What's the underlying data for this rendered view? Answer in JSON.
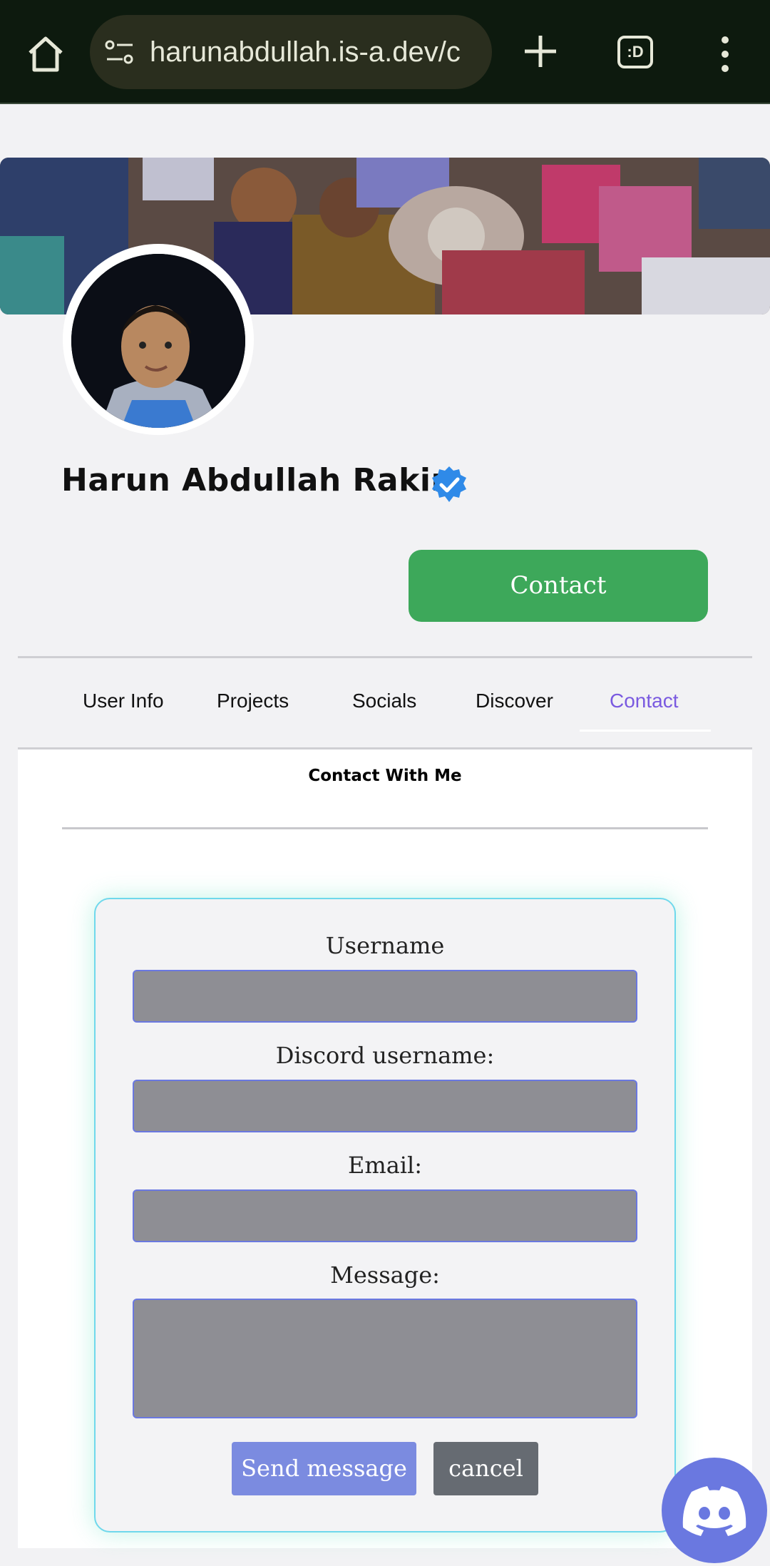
{
  "browser": {
    "url": "harunabdullah.is-a.dev/c",
    "tabs_label": ":D",
    "icons": [
      "home-icon",
      "site-settings-icon",
      "new-tab-icon",
      "tab-switcher-icon",
      "menu-icon"
    ]
  },
  "profile": {
    "name": "Harun Abdullah Rakin",
    "verified": true,
    "contact_button": "Contact"
  },
  "tabs": [
    {
      "label": "User Info",
      "active": false
    },
    {
      "label": "Projects",
      "active": false
    },
    {
      "label": "Socials",
      "active": false
    },
    {
      "label": "Discover",
      "active": false
    },
    {
      "label": "Contact",
      "active": true
    }
  ],
  "contact_section": {
    "title": "Contact With Me",
    "form": {
      "username_label": "Username",
      "discord_label": "Discord username:",
      "email_label": "Email:",
      "message_label": "Message:",
      "send_button": "Send message",
      "cancel_button": "cancel"
    }
  },
  "colors": {
    "chrome_bg": "#0d1a0e",
    "contact_button": "#3da85a",
    "active_tab": "#7a5ae0",
    "send_button": "#7b8be0",
    "cancel_button": "#666b72",
    "discord": "#6a78e0"
  }
}
